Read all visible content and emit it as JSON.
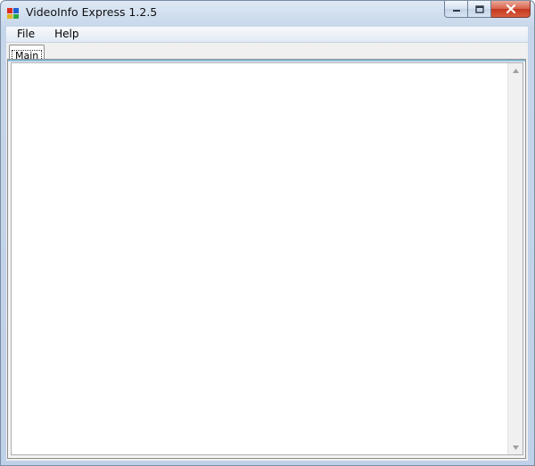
{
  "window": {
    "title": "VideoInfo Express 1.2.5"
  },
  "menu": {
    "items": [
      {
        "label": "File"
      },
      {
        "label": "Help"
      }
    ]
  },
  "tabs": [
    {
      "label": "Main",
      "selected": true
    }
  ],
  "main": {
    "text_area_value": ""
  },
  "icons": {
    "app": "videoinfo-app-icon",
    "minimize": "minimize-icon",
    "maximize": "maximize-icon",
    "close": "close-icon",
    "scroll_up": "arrow-up-icon",
    "scroll_down": "arrow-down-icon"
  },
  "colors": {
    "close_button": "#c4371f",
    "tab_accent": "#8bbcd8"
  }
}
